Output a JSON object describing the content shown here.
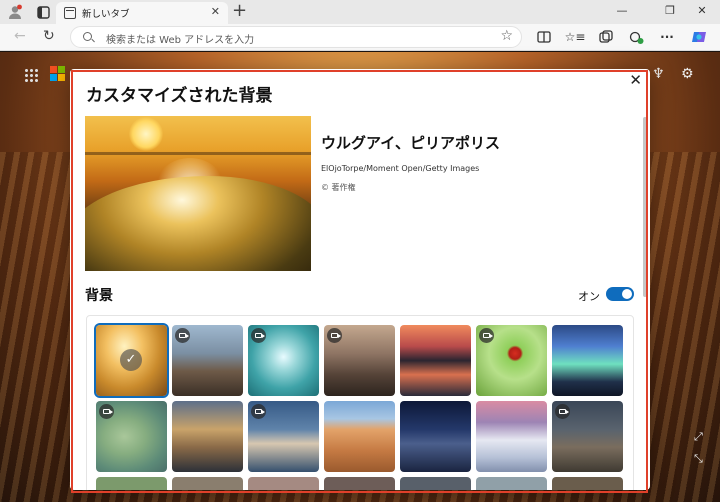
{
  "browser": {
    "tab_title": "新しいタブ",
    "address_placeholder": "検索または Web アドレスを入力"
  },
  "colors": {
    "accent": "#0f6cbd",
    "highlight_frame": "#e0402a"
  },
  "icons": {
    "tabstrip": [
      "profile-icon",
      "workspaces-icon",
      "tab-favicon-icon",
      "close-icon",
      "new-tab-icon",
      "minimize-icon",
      "restore-icon",
      "window-close-icon"
    ],
    "toolbar": [
      "back-icon",
      "refresh-icon",
      "search-icon",
      "favorite-star-icon",
      "split-screen-icon",
      "favorites-icon",
      "collections-icon",
      "extensions-icon",
      "more-icon",
      "copilot-icon"
    ],
    "page": [
      "apps-grid-icon",
      "microsoft-logo",
      "rewards-icon",
      "settings-gear-icon"
    ]
  },
  "dialog": {
    "title": "カスタマイズされた背景",
    "featured": {
      "title": "ウルグアイ、ピリアポリス",
      "credit": "ElOjoTorpe/Moment Open/Getty Images",
      "copyright": "© 著作権"
    },
    "section_title": "背景",
    "toggle": {
      "label": "オン",
      "state": "on"
    },
    "thumbnails": [
      {
        "name": "ocean-wave-sunset",
        "video": false,
        "selected": true
      },
      {
        "name": "city-canal",
        "video": true,
        "selected": false
      },
      {
        "name": "water-drop",
        "video": true,
        "selected": false
      },
      {
        "name": "misty-mountains",
        "video": true,
        "selected": false
      },
      {
        "name": "mountain-lake-sunset",
        "video": false,
        "selected": false
      },
      {
        "name": "ladybug-leaf",
        "video": true,
        "selected": false
      },
      {
        "name": "aurora-borealis",
        "video": false,
        "selected": false
      },
      {
        "name": "aerial-map",
        "video": true,
        "selected": false
      },
      {
        "name": "coastal-town",
        "video": false,
        "selected": false
      },
      {
        "name": "island-city",
        "video": true,
        "selected": false
      },
      {
        "name": "desert-dunes",
        "video": false,
        "selected": false
      },
      {
        "name": "milky-way-peaks",
        "video": false,
        "selected": false
      },
      {
        "name": "snowy-slopes",
        "video": false,
        "selected": false
      },
      {
        "name": "storm-clouds",
        "video": true,
        "selected": false
      }
    ]
  }
}
